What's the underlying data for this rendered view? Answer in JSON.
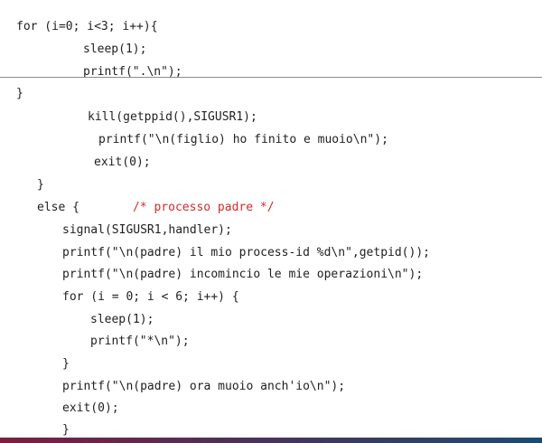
{
  "code_lines": [
    "for (i=0; i<3; i++){",
    "sleep(1);",
    "printf(\".\\n\");",
    "}",
    "kill(getppid(),SIGUSR1);",
    "printf(\"\\n(figlio) ho finito e muoio\\n\");",
    "exit(0);",
    "}",
    "else {",
    "/* processo padre */",
    "signal(SIGUSR1,handler);",
    "printf(\"\\n(padre) il mio process-id %d\\n\",getpid());",
    "printf(\"\\n(padre) incomincio le mie operazioni\\n\");",
    "for (i = 0; i < 6; i++) {",
    "sleep(1);",
    "printf(\"*\\n\");",
    "}",
    "printf(\"\\n(padre) ora muoio anch'io\\n\");",
    "exit(0);",
    "}"
  ],
  "colors": {
    "text": "#1f1f1f",
    "comment": "#d42a2a",
    "separator": "#8c8c8c",
    "bar_start": "#7a1f3d",
    "bar_end": "#1f4a6e"
  }
}
